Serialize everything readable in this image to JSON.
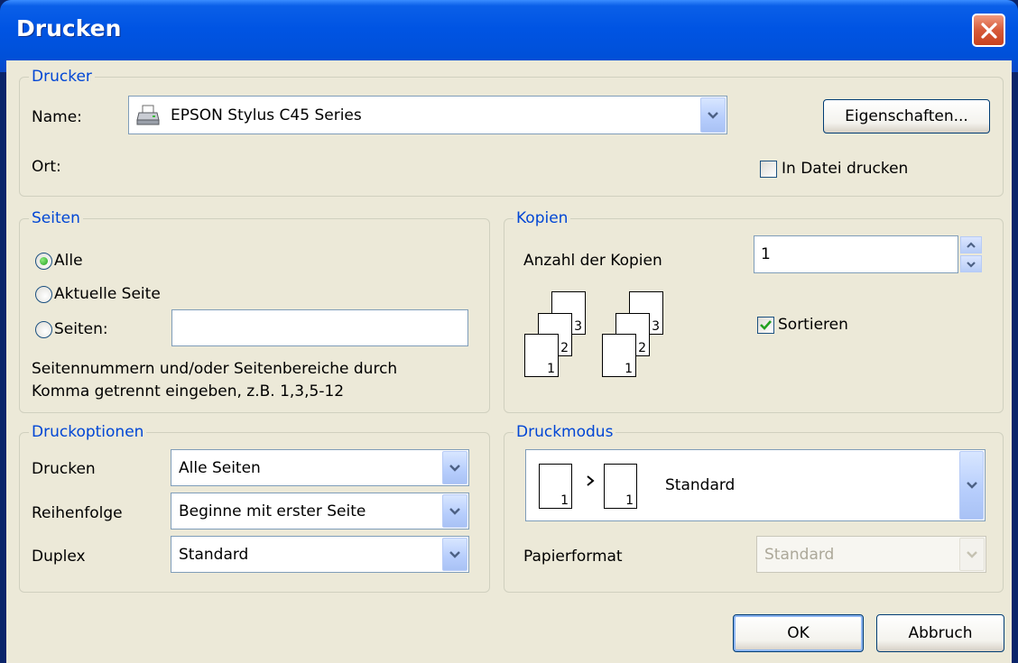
{
  "window": {
    "title": "Drucken"
  },
  "drucker": {
    "legend": "Drucker",
    "name_label": "Name:",
    "printer_selected": "EPSON Stylus C45 Series",
    "properties_button": "Eigenschaften...",
    "location_label": "Ort:",
    "print_to_file_label": "In Datei drucken",
    "print_to_file_checked": false
  },
  "seiten": {
    "legend": "Seiten",
    "all_label": "Alle",
    "current_label": "Aktuelle Seite",
    "pages_label": "Seiten:",
    "pages_value": "",
    "selected": "Alle",
    "hint_line1": "Seitennummern und/oder Seitenbereiche durch",
    "hint_line2": "Komma getrennt eingeben, z.B. 1,3,5-12"
  },
  "kopien": {
    "legend": "Kopien",
    "count_label": "Anzahl der Kopien",
    "count_value": "1",
    "collate_label": "Sortieren",
    "collate_checked": true,
    "page_numbers": [
      "1",
      "2",
      "3"
    ]
  },
  "druckoptionen": {
    "legend": "Druckoptionen",
    "print_label": "Drucken",
    "print_value": "Alle Seiten",
    "order_label": "Reihenfolge",
    "order_value": "Beginne mit erster Seite",
    "duplex_label": "Duplex",
    "duplex_value": "Standard"
  },
  "druckmodus": {
    "legend": "Druckmodus",
    "mode_value": "Standard",
    "mode_page_number": "1",
    "paper_label": "Papierformat",
    "paper_value": "Standard"
  },
  "buttons": {
    "ok": "OK",
    "cancel": "Abbruch"
  },
  "colors": {
    "titlebar": "#0054e3",
    "face": "#ece9d8",
    "legend": "#0046d5",
    "close": "#d65a3a"
  }
}
